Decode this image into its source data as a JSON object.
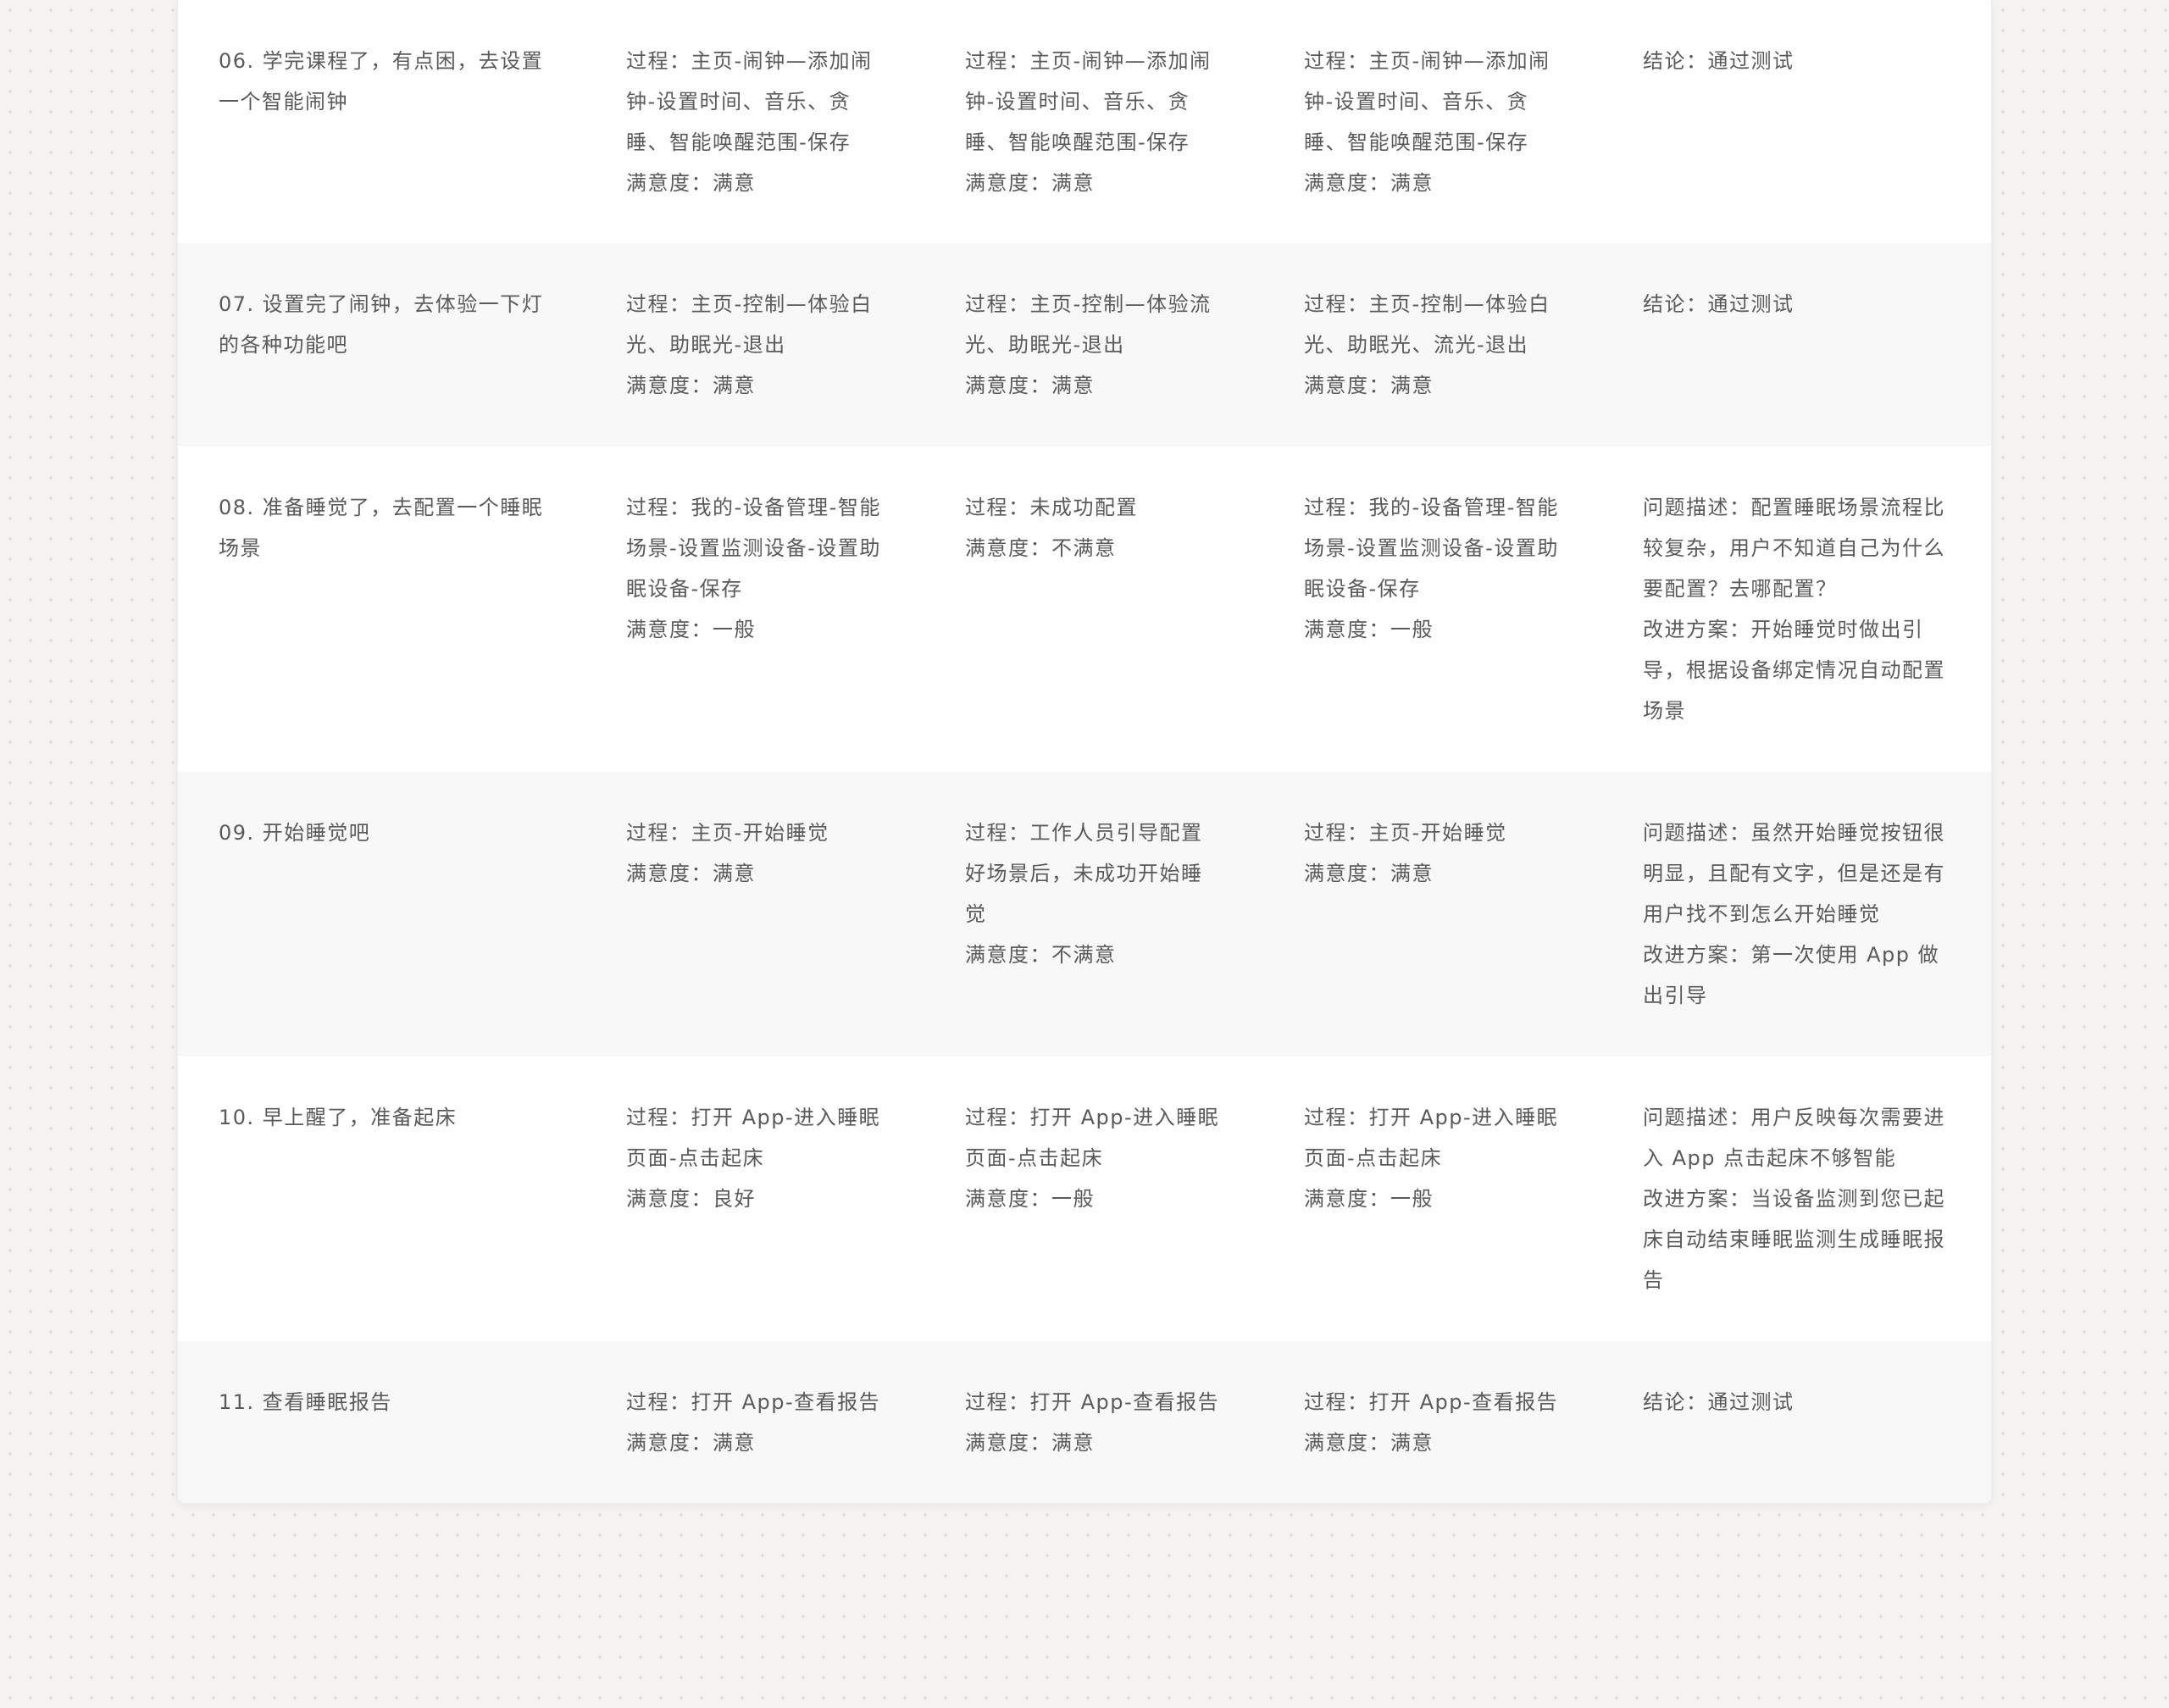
{
  "rows": [
    {
      "task": [
        "06. 学完课程了，有点困，去设置",
        "一个智能闹钟"
      ],
      "user1": [
        "过程：主页-闹钟—添加闹",
        "钟-设置时间、音乐、贪",
        "睡、智能唤醒范围-保存",
        "满意度：满意"
      ],
      "user2": [
        "过程：主页-闹钟—添加闹",
        "钟-设置时间、音乐、贪",
        "睡、智能唤醒范围-保存",
        "满意度：满意"
      ],
      "user3": [
        "过程：主页-闹钟—添加闹",
        "钟-设置时间、音乐、贪",
        "睡、智能唤醒范围-保存",
        "满意度：满意"
      ],
      "result": [
        "结论：通过测试"
      ]
    },
    {
      "task": [
        "07. 设置完了闹钟，去体验一下灯",
        "的各种功能吧"
      ],
      "user1": [
        "过程：主页-控制—体验白",
        "光、助眠光-退出",
        "满意度：满意"
      ],
      "user2": [
        "过程：主页-控制—体验流",
        "光、助眠光-退出",
        "满意度：满意"
      ],
      "user3": [
        "过程：主页-控制—体验白",
        "光、助眠光、流光-退出",
        "满意度：满意"
      ],
      "result": [
        "结论：通过测试"
      ]
    },
    {
      "task": [
        "08. 准备睡觉了，去配置一个睡眠",
        "场景"
      ],
      "user1": [
        "过程：我的-设备管理-智能",
        "场景-设置监测设备-设置助",
        "眠设备-保存",
        "满意度：一般"
      ],
      "user2": [
        "过程：未成功配置",
        "满意度：不满意"
      ],
      "user3": [
        "过程：我的-设备管理-智能",
        "场景-设置监测设备-设置助",
        "眠设备-保存",
        "满意度：一般"
      ],
      "result": [
        "问题描述：配置睡眠场景流程比",
        "较复杂，用户不知道自己为什么",
        "要配置？去哪配置？",
        "改进方案：开始睡觉时做出引",
        "导，根据设备绑定情况自动配置",
        "场景"
      ]
    },
    {
      "task": [
        "09. 开始睡觉吧"
      ],
      "user1": [
        "过程：主页-开始睡觉",
        "满意度：满意"
      ],
      "user2": [
        "过程：工作人员引导配置",
        "好场景后，未成功开始睡",
        "觉",
        "满意度：不满意"
      ],
      "user3": [
        "过程：主页-开始睡觉",
        "满意度：满意"
      ],
      "result": [
        "问题描述：虽然开始睡觉按钮很",
        "明显，且配有文字，但是还是有",
        "用户找不到怎么开始睡觉",
        "改进方案：第一次使用 App 做",
        "出引导"
      ]
    },
    {
      "task": [
        "10. 早上醒了，准备起床"
      ],
      "user1": [
        "过程：打开 App-进入睡眠",
        "页面-点击起床",
        "满意度：良好"
      ],
      "user2": [
        "过程：打开 App-进入睡眠",
        "页面-点击起床",
        "满意度：一般"
      ],
      "user3": [
        "过程：打开 App-进入睡眠",
        "页面-点击起床",
        "满意度：一般"
      ],
      "result": [
        "问题描述：用户反映每次需要进",
        "入 App 点击起床不够智能",
        "改进方案：当设备监测到您已起",
        "床自动结束睡眠监测生成睡眠报",
        "告"
      ]
    },
    {
      "task": [
        "11. 查看睡眠报告"
      ],
      "user1": [
        "过程：打开 App-查看报告",
        "满意度：满意"
      ],
      "user2": [
        "过程：打开 App-查看报告",
        "满意度：满意"
      ],
      "user3": [
        "过程：打开 App-查看报告",
        "满意度：满意"
      ],
      "result": [
        "结论：通过测试"
      ]
    }
  ]
}
